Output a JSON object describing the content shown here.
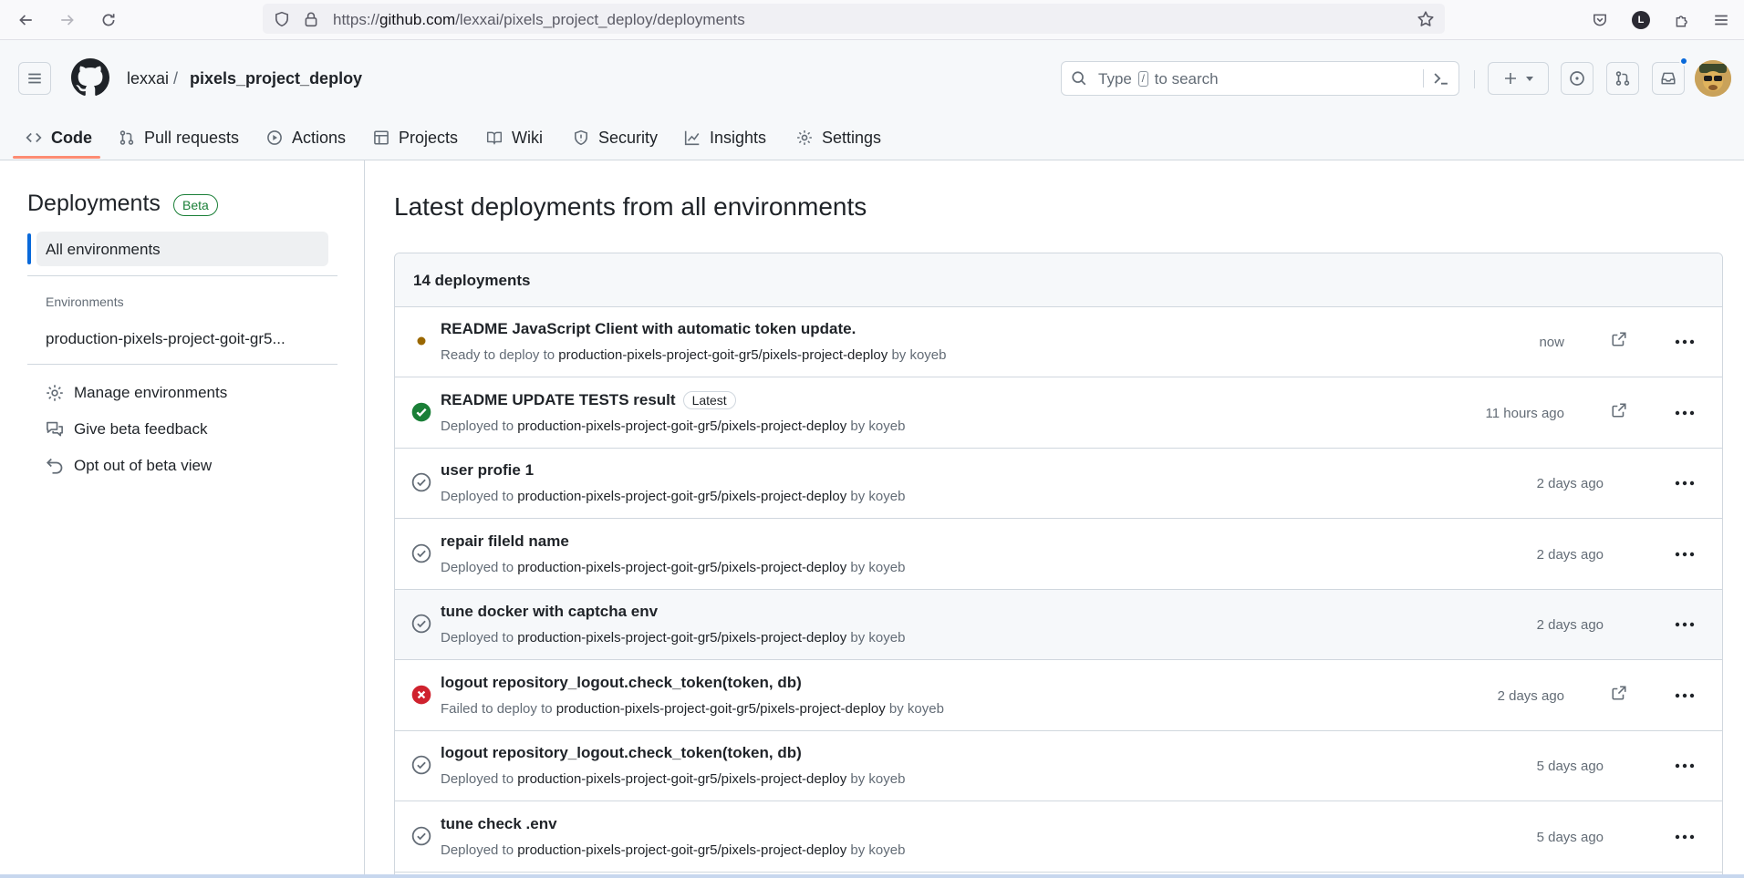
{
  "browser": {
    "url_prefix": "https://",
    "url_domain": "github.com",
    "url_path": "/lexxai/pixels_project_deploy/deployments",
    "profile_letter": "L"
  },
  "header": {
    "owner": "lexxai",
    "separator": "/",
    "repo": "pixels_project_deploy",
    "search_before": "Type",
    "search_key": "/",
    "search_after": "to search"
  },
  "tabs": [
    {
      "label": "Code",
      "icon": "code-icon"
    },
    {
      "label": "Pull requests",
      "icon": "pull-request-icon"
    },
    {
      "label": "Actions",
      "icon": "play-icon"
    },
    {
      "label": "Projects",
      "icon": "table-icon"
    },
    {
      "label": "Wiki",
      "icon": "book-icon"
    },
    {
      "label": "Security",
      "icon": "shield-icon"
    },
    {
      "label": "Insights",
      "icon": "graph-icon"
    },
    {
      "label": "Settings",
      "icon": "gear-icon"
    }
  ],
  "sidebar": {
    "title": "Deployments",
    "badge": "Beta",
    "active_item": "All environments",
    "section_label": "Environments",
    "environment": "production-pixels-project-goit-gr5...",
    "actions": [
      {
        "label": "Manage environments",
        "icon": "gear-icon"
      },
      {
        "label": "Give beta feedback",
        "icon": "comment-discussion-icon"
      },
      {
        "label": "Opt out of beta view",
        "icon": "undo-icon"
      }
    ]
  },
  "main": {
    "title": "Latest deployments from all environments",
    "count": "14 deployments",
    "rows": [
      {
        "title": "README JavaScript Client with automatic token update.",
        "badge": "",
        "status": "pending",
        "prefix": "Ready to deploy to",
        "env": "production-pixels-project-goit-gr5/pixels-project-deploy",
        "by": "by koyeb",
        "time": "now",
        "link": true,
        "highlight": false
      },
      {
        "title": "README UPDATE TESTS result",
        "badge": "Latest",
        "status": "success",
        "prefix": "Deployed to",
        "env": "production-pixels-project-goit-gr5/pixels-project-deploy",
        "by": "by koyeb",
        "time": "11 hours ago",
        "link": true,
        "highlight": false
      },
      {
        "title": "user profie 1",
        "badge": "",
        "status": "inactive",
        "prefix": "Deployed to",
        "env": "production-pixels-project-goit-gr5/pixels-project-deploy",
        "by": "by koyeb",
        "time": "2 days ago",
        "link": false,
        "highlight": false
      },
      {
        "title": "repair fileld name",
        "badge": "",
        "status": "inactive",
        "prefix": "Deployed to",
        "env": "production-pixels-project-goit-gr5/pixels-project-deploy",
        "by": "by koyeb",
        "time": "2 days ago",
        "link": false,
        "highlight": false
      },
      {
        "title": "tune docker with captcha env",
        "badge": "",
        "status": "inactive",
        "prefix": "Deployed to",
        "env": "production-pixels-project-goit-gr5/pixels-project-deploy",
        "by": "by koyeb",
        "time": "2 days ago",
        "link": false,
        "highlight": true
      },
      {
        "title": "logout repository_logout.check_token(token, db)",
        "badge": "",
        "status": "failed",
        "prefix": "Failed to deploy to",
        "env": "production-pixels-project-goit-gr5/pixels-project-deploy",
        "by": "by koyeb",
        "time": "2 days ago",
        "link": true,
        "highlight": false
      },
      {
        "title": "logout repository_logout.check_token(token, db)",
        "badge": "",
        "status": "inactive",
        "prefix": "Deployed to",
        "env": "production-pixels-project-goit-gr5/pixels-project-deploy",
        "by": "by koyeb",
        "time": "5 days ago",
        "link": false,
        "highlight": false
      },
      {
        "title": "tune check .env",
        "badge": "",
        "status": "inactive",
        "prefix": "Deployed to",
        "env": "production-pixels-project-goit-gr5/pixels-project-deploy",
        "by": "by koyeb",
        "time": "5 days ago",
        "link": false,
        "highlight": false
      }
    ]
  },
  "colors": {
    "accent": "#0969da",
    "success": "#1a7f37",
    "failed": "#cf222e",
    "pending": "#9a6700",
    "tab_underline": "#fd8c73"
  }
}
